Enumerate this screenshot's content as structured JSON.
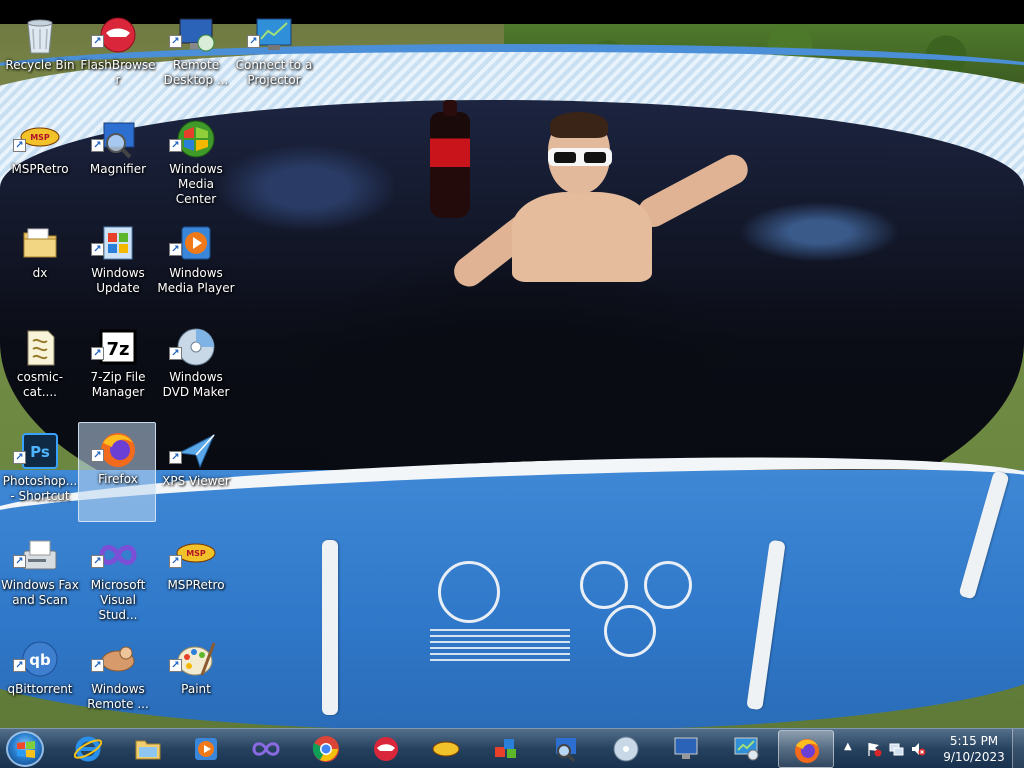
{
  "desktop": {
    "icons": [
      {
        "label": "Recycle Bin",
        "icon": "recycle-bin-icon"
      },
      {
        "label": "FlashBrowser",
        "icon": "flashbrowser-icon"
      },
      {
        "label": "Remote Desktop ...",
        "icon": "remote-desktop-icon"
      },
      {
        "label": "Connect to a Projector",
        "icon": "projector-icon"
      },
      {
        "label": "MSPRetro",
        "icon": "mspretro-icon"
      },
      {
        "label": "Magnifier",
        "icon": "magnifier-icon"
      },
      {
        "label": "Windows Media Center",
        "icon": "media-center-icon"
      },
      {
        "label": "dx",
        "icon": "folder-icon"
      },
      {
        "label": "Windows Update",
        "icon": "windows-update-icon"
      },
      {
        "label": "Windows Media Player",
        "icon": "media-player-icon"
      },
      {
        "label": "cosmic-cat....",
        "icon": "script-file-icon"
      },
      {
        "label": "7-Zip File Manager",
        "icon": "7zip-icon"
      },
      {
        "label": "Windows DVD Maker",
        "icon": "dvd-maker-icon"
      },
      {
        "label": "Photoshop... - Shortcut",
        "icon": "photoshop-icon"
      },
      {
        "label": "Firefox",
        "icon": "firefox-icon"
      },
      {
        "label": "XPS Viewer",
        "icon": "xps-viewer-icon"
      },
      {
        "label": "Windows Fax and Scan",
        "icon": "fax-scan-icon"
      },
      {
        "label": "Microsoft Visual Stud...",
        "icon": "visual-studio-icon"
      },
      {
        "label": "MSPRetro",
        "icon": "mspretro-icon"
      },
      {
        "label": "qBittorrent",
        "icon": "qbittorrent-icon"
      },
      {
        "label": "Windows Remote ...",
        "icon": "remote-assistance-icon"
      },
      {
        "label": "Paint",
        "icon": "paint-icon"
      }
    ],
    "selected_icon": "Firefox"
  },
  "taskbar": {
    "start_icon": "windows-start-orb",
    "pinned": [
      {
        "icon": "internet-explorer-icon"
      },
      {
        "icon": "file-explorer-icon"
      },
      {
        "icon": "media-player-icon"
      },
      {
        "icon": "visual-studio-icon"
      },
      {
        "icon": "chrome-icon"
      },
      {
        "icon": "flashbrowser-icon"
      },
      {
        "icon": "mspretro-icon"
      },
      {
        "icon": "3d-shapes-icon"
      },
      {
        "icon": "magnifier-icon"
      },
      {
        "icon": "dvd-maker-icon"
      },
      {
        "icon": "remote-desktop-icon"
      },
      {
        "icon": "projector-icon"
      },
      {
        "icon": "firefox-icon"
      }
    ],
    "tray": {
      "icons": [
        "show-hidden-icons",
        "action-center-flag-icon",
        "network-icon",
        "volume-muted-icon"
      ],
      "time": "5:15 PM",
      "date": "9/10/2023"
    }
  },
  "colors": {
    "taskbar": "#2a4a6e",
    "selection": "#bed7f0",
    "pool_blue": "#2f77c8"
  }
}
